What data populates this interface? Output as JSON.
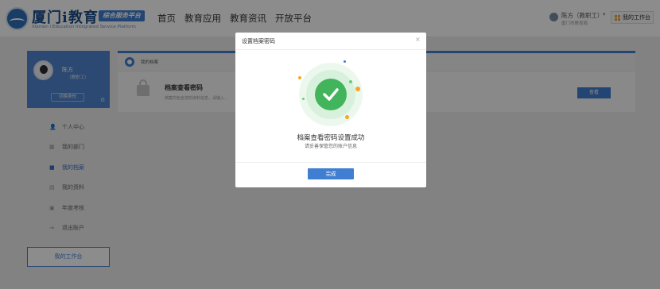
{
  "header": {
    "logo_title": "厦门i教育",
    "logo_badge": "综合服务平台",
    "logo_subtitle": "Xiamen i Education Integrated Service Platform",
    "nav": [
      "首页",
      "教育应用",
      "教育资讯",
      "开放平台"
    ],
    "user_name": "陈方（教职工）",
    "user_sub": "厦门市教育局",
    "workbench_label": "我的工作台"
  },
  "sidebar": {
    "profile_name": "陈方",
    "profile_role": "（教职工）",
    "switch_label": "切换身份",
    "items": [
      {
        "icon": "user-icon",
        "label": "个人中心"
      },
      {
        "icon": "department-icon",
        "label": "我的部门"
      },
      {
        "icon": "folder-icon",
        "label": "我的档案",
        "active": true
      },
      {
        "icon": "document-icon",
        "label": "我的资料"
      },
      {
        "icon": "review-icon",
        "label": "年度考核"
      },
      {
        "icon": "logout-icon",
        "label": "退出账户"
      }
    ],
    "workbench_label": "我的工作台"
  },
  "main": {
    "section_title": "我的档案",
    "archive_title": "档案查看密码",
    "archive_desc": "档案内包含您的资料信息，请输入…",
    "view_label": "查看"
  },
  "modal": {
    "title": "设置档案密码",
    "close_symbol": "×",
    "success_text": "档案查看密码设置成功",
    "success_sub": "请妥善保管您的账户信息",
    "done_label": "完成"
  },
  "colors": {
    "accent": "#3f7ed1",
    "success": "#42b45c"
  }
}
